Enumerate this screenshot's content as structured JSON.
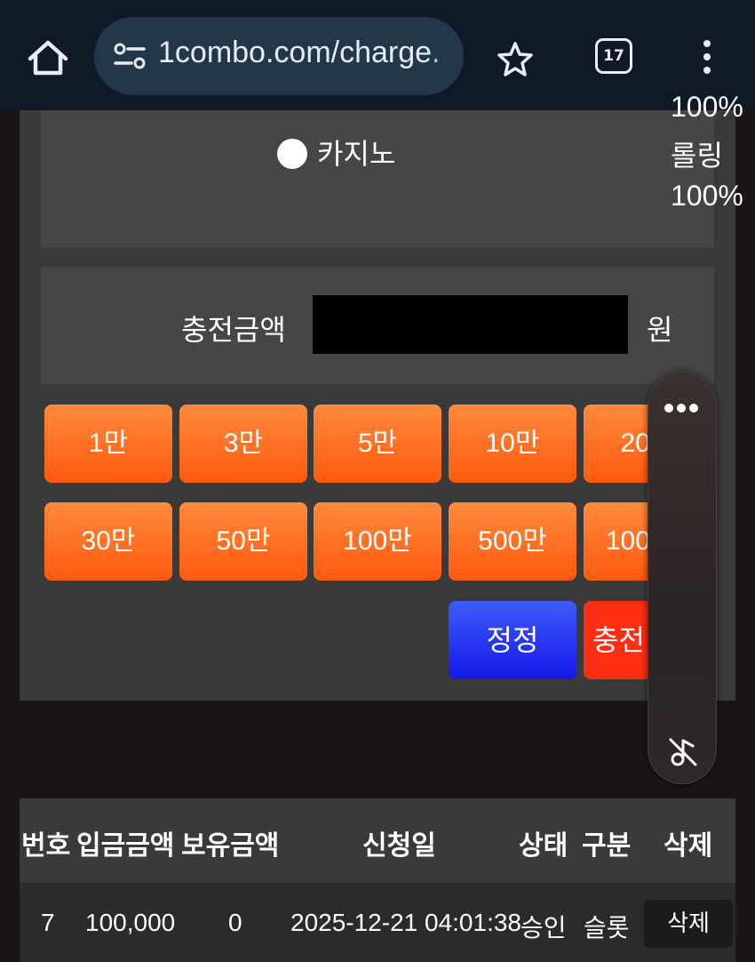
{
  "browser": {
    "url": "1combo.com/charge.",
    "tab_count": "17"
  },
  "game_select": {
    "option_label": "카지노",
    "rate_lines": [
      "100%",
      "롤링",
      "100%"
    ]
  },
  "charge_form": {
    "amount_label": "충전금액",
    "amount_value": "",
    "unit_label": "원"
  },
  "amount_buttons": {
    "row1": [
      "1만",
      "3만",
      "5만",
      "10만",
      "20만"
    ],
    "row2": [
      "30만",
      "50만",
      "100만",
      "500만",
      "1000만"
    ]
  },
  "actions": {
    "reset_label": "정정",
    "charge_label": "충전"
  },
  "history_table": {
    "headers": [
      "번호",
      "입금금액",
      "보유금액",
      "신청일",
      "상태",
      "구분",
      "삭제"
    ],
    "rows": [
      [
        "7",
        "100,000",
        "0",
        "2025-12-21 04:01:38",
        "승인",
        "슬롯",
        "삭제"
      ]
    ]
  },
  "colors": {
    "chip_gradient_top": "#ff8a3d",
    "chip_gradient_bottom": "#ff5a0e",
    "reset_button": "#1518e6",
    "charge_button": "#ff2d12",
    "browser_bar": "#0f1a26"
  },
  "icons": {
    "home": "home-icon",
    "site_info": "tune-icon",
    "bookmark": "star-icon",
    "tabs": "tab-switcher-icon",
    "menu": "more-vert-icon",
    "widget_menu": "more-horiz-icon",
    "widget_action": "music-off-icon"
  }
}
